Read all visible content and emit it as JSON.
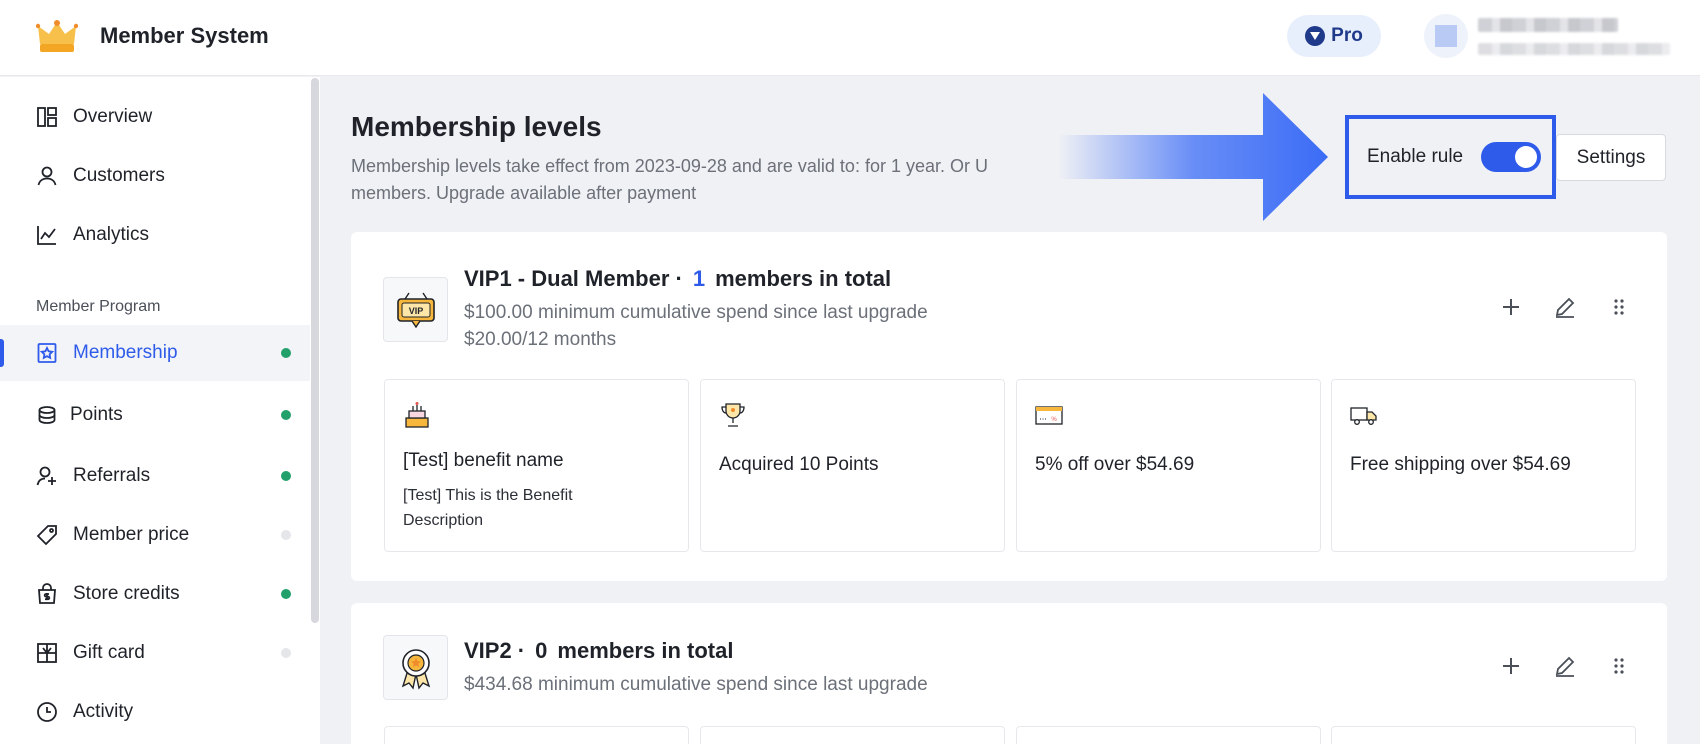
{
  "header": {
    "app_title": "Member System",
    "pro_label": "Pro"
  },
  "sidebar": {
    "items_top": [
      {
        "label": "Overview",
        "icon": "overview-icon"
      },
      {
        "label": "Customers",
        "icon": "user-icon"
      },
      {
        "label": "Analytics",
        "icon": "line-chart-icon"
      }
    ],
    "section_label": "Member Program",
    "items_program": [
      {
        "label": "Membership",
        "icon": "badge-star-icon",
        "active": true,
        "status": "on"
      },
      {
        "label": "Points",
        "icon": "coins-icon",
        "status": "on"
      },
      {
        "label": "Referrals",
        "icon": "user-plus-icon",
        "status": "on"
      },
      {
        "label": "Member price",
        "icon": "tag-icon",
        "status": "off"
      },
      {
        "label": "Store credits",
        "icon": "shopping-bag-dollar-icon",
        "status": "on"
      },
      {
        "label": "Gift card",
        "icon": "gift-card-icon",
        "status": "off"
      },
      {
        "label": "Activity",
        "icon": "clock-icon"
      }
    ]
  },
  "main": {
    "title": "Membership levels",
    "description_line1": "Membership levels take effect from 2023-09-28 and are valid to: for 1 year. Or U",
    "description_line2": "members. Upgrade available after payment",
    "enable_rule_label": "Enable rule",
    "enable_rule_on": true,
    "settings_label": "Settings",
    "levels": [
      {
        "name": "VIP1 - Dual Member ·",
        "count": "1",
        "count_suffix": "members in total",
        "line1": "$100.00 minimum cumulative spend since last upgrade",
        "line2": "$20.00/12 months",
        "benefits": [
          {
            "icon": "cake-icon",
            "title": "[Test] benefit name",
            "desc": "[Test] This is the Benefit Description"
          },
          {
            "icon": "trophy-icon",
            "title": "Acquired 10 Points"
          },
          {
            "icon": "discount-card-icon",
            "title": "5% off over $54.69"
          },
          {
            "icon": "truck-icon",
            "title": "Free shipping over $54.69"
          }
        ]
      },
      {
        "name": "VIP2 ·",
        "count": "0",
        "count_suffix": "members in total",
        "line1": "$434.68 minimum cumulative spend since last upgrade"
      }
    ]
  },
  "colors": {
    "accent": "#2f5bea",
    "status_on": "#22a06b",
    "status_off": "#e4e6ea",
    "highlight_border": "#2f5bea"
  }
}
